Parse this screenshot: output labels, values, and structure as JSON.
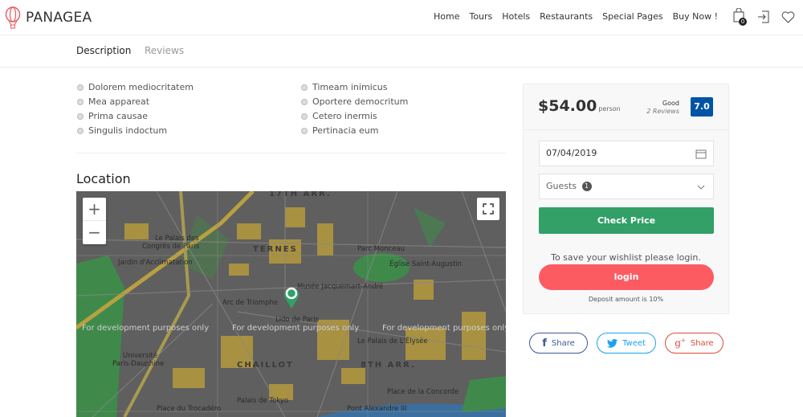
{
  "header": {
    "brand": "PANAGEA",
    "nav": [
      "Home",
      "Tours",
      "Hotels",
      "Restaurants",
      "Special Pages",
      "Buy Now !"
    ],
    "cart_count": "0"
  },
  "tabs": [
    {
      "label": "Description",
      "active": true
    },
    {
      "label": "Reviews",
      "active": false
    }
  ],
  "features": {
    "left": [
      "Dolorem mediocritatem",
      "Mea appareat",
      "Prima causae",
      "Singulis indoctum"
    ],
    "right": [
      "Timeam inimicus",
      "Oportere democritum",
      "Cetero inermis",
      "Pertinacia eum"
    ]
  },
  "location": {
    "title": "Location",
    "map": {
      "districts": [
        "17TH ARR.",
        "TERNES",
        "CHAILLOT",
        "8TH ARR."
      ],
      "places": [
        "Le Palais des",
        "Congrès de Paris",
        "Parc Monceau",
        "Jardin d'Acclimatation",
        "Église Saint-Augustin",
        "Musée Jacquemart-André",
        "Arc de Triomphe",
        "Lido de Paris",
        "Le Palais de L'Élysée",
        "Université",
        "Paris-Dauphine",
        "Place de la Concorde",
        "Palais de Tokyo",
        "Pont Alexandre III",
        "Place du Trocadéro"
      ],
      "watermark": "For development purposes only",
      "zoom_in": "+",
      "zoom_out": "−"
    }
  },
  "booking": {
    "price": "$54.00",
    "unit": "person",
    "rating_label": "Good",
    "reviews": "2 Reviews",
    "score": "7.0",
    "date": "07/04/2019",
    "guests_label": "Guests",
    "guests_count": "1",
    "check_price": "Check Price",
    "wishlist_text": "To save your wishlist please login.",
    "login": "login",
    "deposit": "Deposit amount is 10%"
  },
  "share": [
    {
      "label": "Share",
      "network": "facebook",
      "color": "#3b5998"
    },
    {
      "label": "Tweet",
      "network": "twitter",
      "color": "#1da1f2"
    },
    {
      "label": "Share",
      "network": "google-plus",
      "color": "#dd4b39"
    }
  ],
  "colors": {
    "accent_green": "#32a067",
    "accent_red": "#fc5b62",
    "score_blue": "#0054a6"
  }
}
